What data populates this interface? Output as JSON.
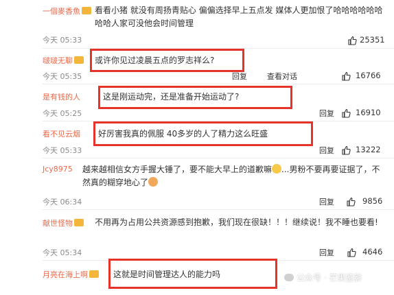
{
  "comments": [
    {
      "user": "一個麥香魚",
      "text": "看看小猪 就没有周扬青贴心 偏偏选择早上五点发 媒体人更加恨了哈哈哈哈哈哈哈哈人家可没他会时间管理",
      "time": "今天 05:33",
      "likes": "25351"
    },
    {
      "user": "啵啵无聊",
      "text": "或许你见过凌晨五点的罗志祥么?",
      "time": "今天 05:35",
      "reply": "回复",
      "convo": "查看对话",
      "likes": "16766"
    },
    {
      "user": "是有钱的人",
      "text": "这是刚运动完，还是准备开始运动了?",
      "time": "今天 05:25",
      "reply": "回复",
      "likes": "16910"
    },
    {
      "user": "看不见云烟",
      "text": "好厉害我真的佩服 40多岁的人了精力这么旺盛",
      "time": "今天 05:33",
      "reply": "回复",
      "likes": "13222"
    },
    {
      "user": "Jcy8975",
      "text": "越来越相信女方手握大锤了，要不能大早上的道歉嘛",
      "text2": "...男粉不要再要证据了，不然真的糊穿地心了",
      "time": "今天 06:34",
      "reply": "回复",
      "likes": "9856"
    },
    {
      "user": "献世怪物",
      "text": "不用再为占用公共资源感到抱歉，我们现在很缺！！！继续说！我不睡也要看!",
      "time": "今天 05:34",
      "reply": "回复",
      "likes": "4646"
    },
    {
      "user": "月亮在海上啊",
      "text": "这就是时间管理达人的能力吗"
    }
  ],
  "watermark": "公众号 · 芒果鉴影",
  "accent": "#e5332a"
}
